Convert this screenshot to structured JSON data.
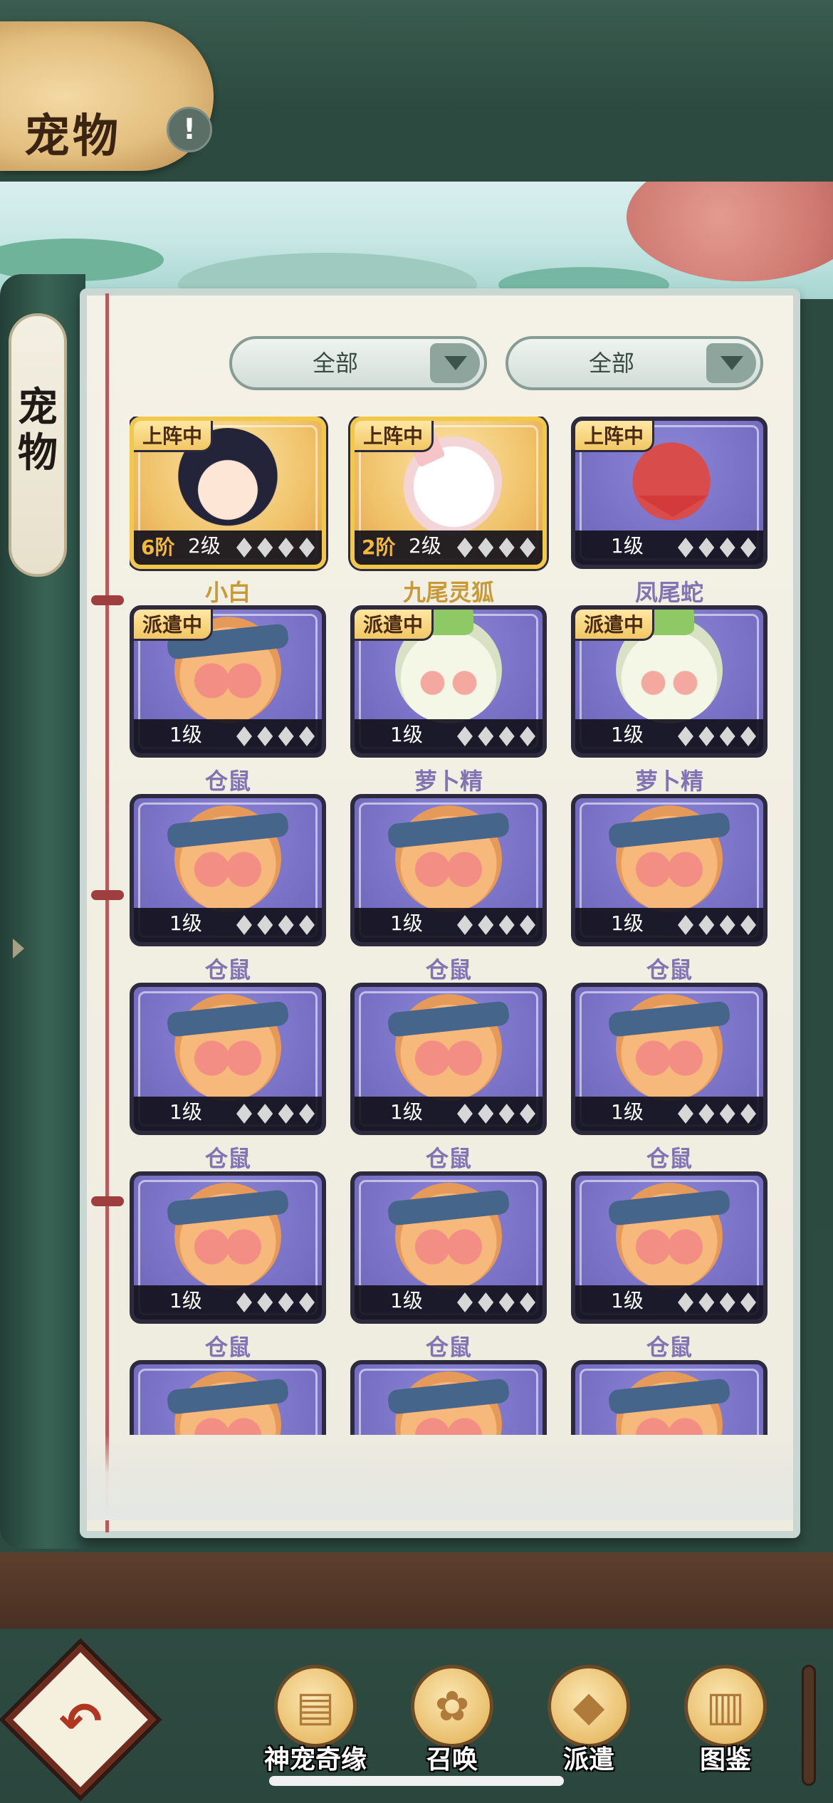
{
  "header": {
    "title": "宠物",
    "info_icon": "exclamation-icon"
  },
  "spine": {
    "label": "宠\n物"
  },
  "filters": [
    {
      "value": "全部"
    },
    {
      "value": "全部"
    }
  ],
  "pets": [
    {
      "name": "小白",
      "status": "上阵中",
      "rank": "6阶",
      "level": "2级",
      "art": "girl",
      "frame": "gold"
    },
    {
      "name": "九尾灵狐",
      "status": "上阵中",
      "rank": "2阶",
      "level": "2级",
      "art": "fox",
      "frame": "gold"
    },
    {
      "name": "凤尾蛇",
      "status": "上阵中",
      "rank": "",
      "level": "1级",
      "art": "snake",
      "frame": "purple"
    },
    {
      "name": "仓鼠",
      "status": "派遣中",
      "rank": "",
      "level": "1级",
      "art": "hamster",
      "frame": "purple"
    },
    {
      "name": "萝卜精",
      "status": "派遣中",
      "rank": "",
      "level": "1级",
      "art": "radish",
      "frame": "purple"
    },
    {
      "name": "萝卜精",
      "status": "派遣中",
      "rank": "",
      "level": "1级",
      "art": "radish",
      "frame": "purple"
    },
    {
      "name": "仓鼠",
      "status": "",
      "rank": "",
      "level": "1级",
      "art": "hamster",
      "frame": "purple"
    },
    {
      "name": "仓鼠",
      "status": "",
      "rank": "",
      "level": "1级",
      "art": "hamster",
      "frame": "purple"
    },
    {
      "name": "仓鼠",
      "status": "",
      "rank": "",
      "level": "1级",
      "art": "hamster",
      "frame": "purple"
    },
    {
      "name": "仓鼠",
      "status": "",
      "rank": "",
      "level": "1级",
      "art": "hamster",
      "frame": "purple"
    },
    {
      "name": "仓鼠",
      "status": "",
      "rank": "",
      "level": "1级",
      "art": "hamster",
      "frame": "purple"
    },
    {
      "name": "仓鼠",
      "status": "",
      "rank": "",
      "level": "1级",
      "art": "hamster",
      "frame": "purple"
    },
    {
      "name": "仓鼠",
      "status": "",
      "rank": "",
      "level": "1级",
      "art": "hamster",
      "frame": "purple"
    },
    {
      "name": "仓鼠",
      "status": "",
      "rank": "",
      "level": "1级",
      "art": "hamster",
      "frame": "purple"
    },
    {
      "name": "仓鼠",
      "status": "",
      "rank": "",
      "level": "1级",
      "art": "hamster",
      "frame": "purple"
    },
    {
      "name": "",
      "status": "",
      "rank": "",
      "level": "",
      "art": "hamster",
      "frame": "purple"
    },
    {
      "name": "",
      "status": "",
      "rank": "",
      "level": "",
      "art": "hamster",
      "frame": "purple"
    },
    {
      "name": "",
      "status": "",
      "rank": "",
      "level": "",
      "art": "hamster",
      "frame": "purple"
    }
  ],
  "bottom_nav": {
    "back_icon": "return-arrow-icon",
    "items": [
      {
        "label": "神宠奇缘",
        "icon": "chest-icon"
      },
      {
        "label": "召唤",
        "icon": "paw-icon"
      },
      {
        "label": "派遣",
        "icon": "cat-head-icon"
      },
      {
        "label": "图鉴",
        "icon": "scroll-icon"
      }
    ]
  },
  "colors": {
    "gold_frame": "#f2c84a",
    "purple_card": "#7a72c7",
    "name_purple": "#8074b3",
    "name_gold": "#c79a37",
    "rank_orange": "#f4b83b"
  }
}
